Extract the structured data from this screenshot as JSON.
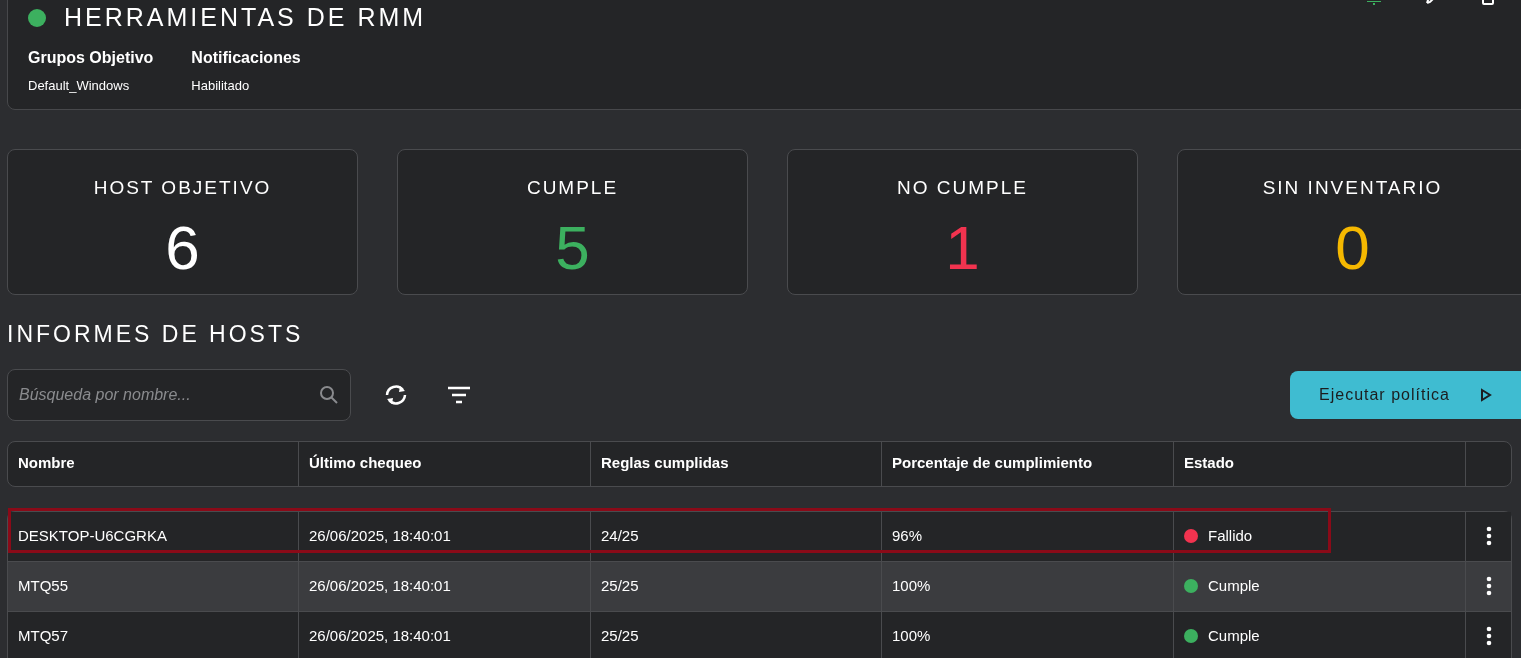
{
  "header": {
    "online": true,
    "title": "HERRAMIENTAS DE RMM",
    "fields": [
      {
        "label": "Grupos Objetivo",
        "value": "Default_Windows"
      },
      {
        "label": "Notificaciones",
        "value": "Habilitado"
      }
    ]
  },
  "stats": [
    {
      "label": "HOST OBJETIVO",
      "value": "6",
      "color": "#ffffff"
    },
    {
      "label": "CUMPLE",
      "value": "5",
      "color": "#3cb05f"
    },
    {
      "label": "NO CUMPLE",
      "value": "1",
      "color": "#f2334f"
    },
    {
      "label": "SIN INVENTARIO",
      "value": "0",
      "color": "#f5b800"
    }
  ],
  "section_title": "INFORMES DE HOSTS",
  "search": {
    "placeholder": "Búsqueda por nombre..."
  },
  "run_button": "Ejecutar política",
  "table": {
    "columns": [
      "Nombre",
      "Último chequeo",
      "Reglas cumplidas",
      "Porcentaje de cumplimiento",
      "Estado"
    ],
    "rows": [
      {
        "name": "DESKTOP-U6CGRKA",
        "last_check": "26/06/2025, 18:40:01",
        "rules": "24/25",
        "percent": "96%",
        "status": "Fallido",
        "color": "#f2334f",
        "highlighted": true,
        "hovered": false
      },
      {
        "name": "MTQ55",
        "last_check": "26/06/2025, 18:40:01",
        "rules": "25/25",
        "percent": "100%",
        "status": "Cumple",
        "color": "#3cb05f",
        "highlighted": false,
        "hovered": true
      },
      {
        "name": "MTQ57",
        "last_check": "26/06/2025, 18:40:01",
        "rules": "25/25",
        "percent": "100%",
        "status": "Cumple",
        "color": "#3cb05f",
        "highlighted": false,
        "hovered": false
      }
    ]
  }
}
